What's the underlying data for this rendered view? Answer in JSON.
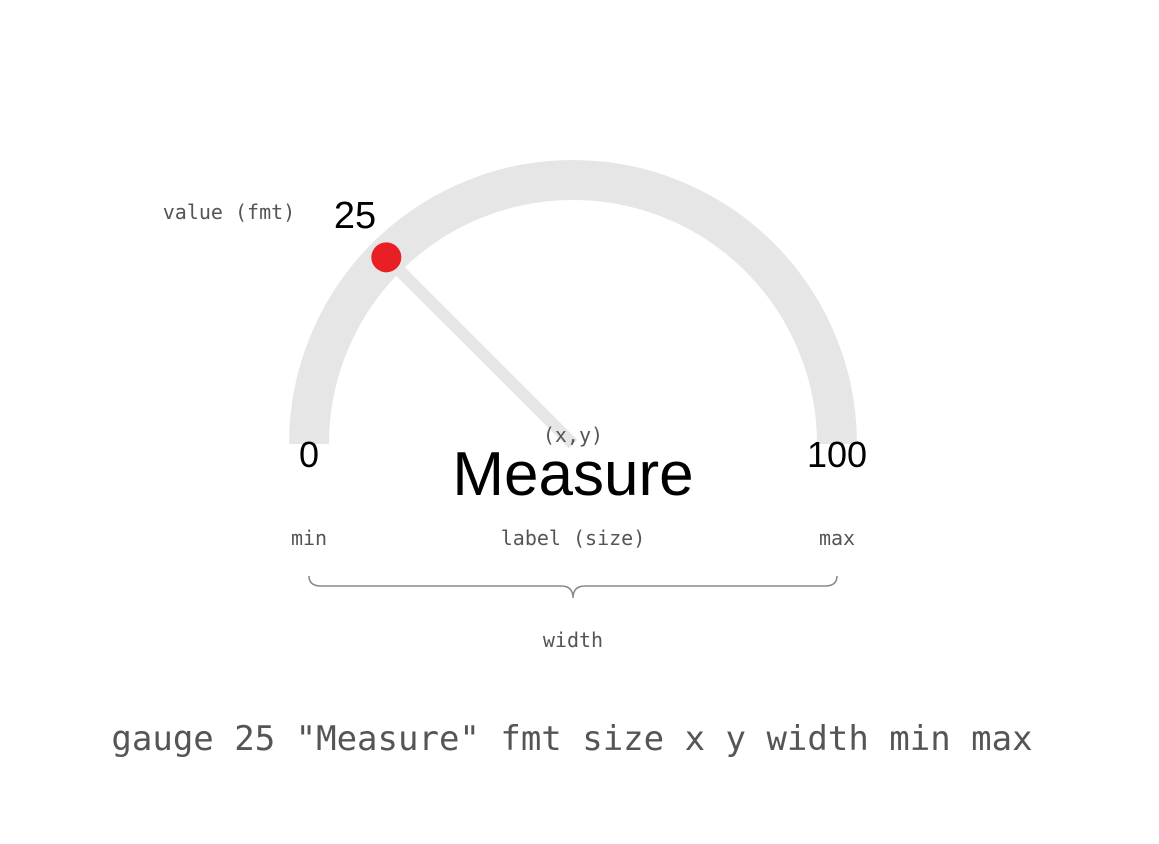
{
  "gauge": {
    "value": 25,
    "value_text": "25",
    "min": 0,
    "min_text": "0",
    "max": 100,
    "max_text": "100",
    "label": "Measure"
  },
  "annotations": {
    "value_fmt": "value (fmt)",
    "center_xy": "(x,y)",
    "min": "min",
    "label_size": "label (size)",
    "max": "max",
    "width": "width"
  },
  "syntax": "gauge 25 \"Measure\" fmt size x y width min max",
  "colors": {
    "track": "#e6e6e6",
    "needle": "#e6e6e6",
    "dot": "#e82026",
    "annotation": "#555555",
    "text": "#000000"
  }
}
